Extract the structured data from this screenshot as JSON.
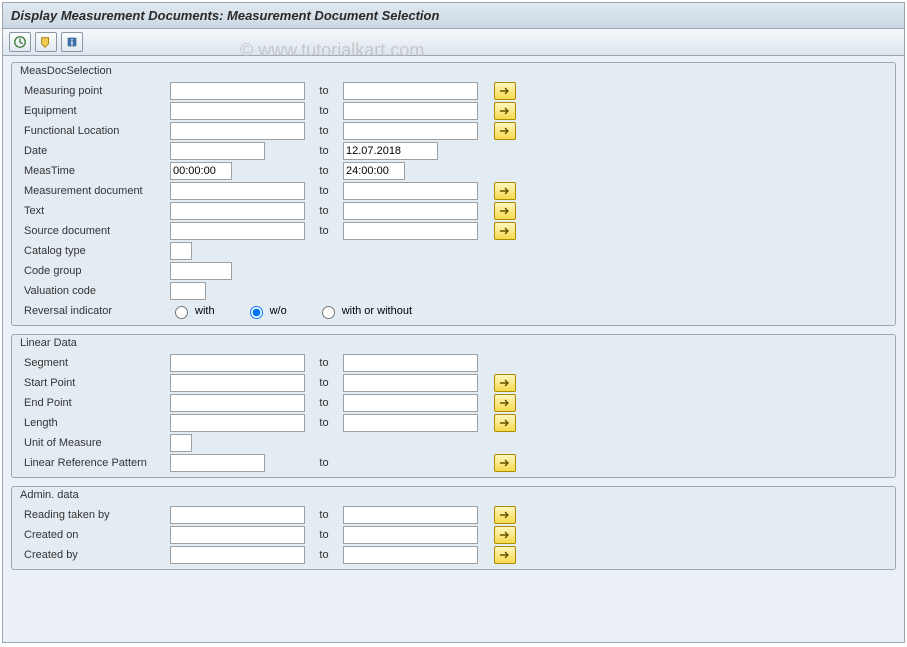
{
  "title": "Display Measurement Documents: Measurement Document Selection",
  "watermark": "© www.tutorialkart.com",
  "groups": {
    "measdoc": {
      "title": "MeasDocSelection",
      "measuring_point": "Measuring point",
      "equipment": "Equipment",
      "functional_location": "Functional Location",
      "date": "Date",
      "date_to_val": "12.07.2018",
      "meastime": "MeasTime",
      "meastime_from_val": "00:00:00",
      "meastime_to_val": "24:00:00",
      "measurement_document": "Measurement document",
      "text": "Text",
      "source_document": "Source document",
      "catalog_type": "Catalog type",
      "code_group": "Code group",
      "valuation_code": "Valuation code",
      "reversal_indicator": "Reversal indicator",
      "rev_with": "with",
      "rev_wo": "w/o",
      "rev_both": "with or without"
    },
    "linear": {
      "title": "Linear Data",
      "segment": "Segment",
      "start_point": "Start Point",
      "end_point": "End Point",
      "length": "Length",
      "unit_of_measure": "Unit of Measure",
      "linear_ref_pattern": "Linear Reference Pattern"
    },
    "admin": {
      "title": "Admin. data",
      "reading_taken_by": "Reading taken by",
      "created_on": "Created on",
      "created_by": "Created by"
    }
  },
  "to_label": "to"
}
